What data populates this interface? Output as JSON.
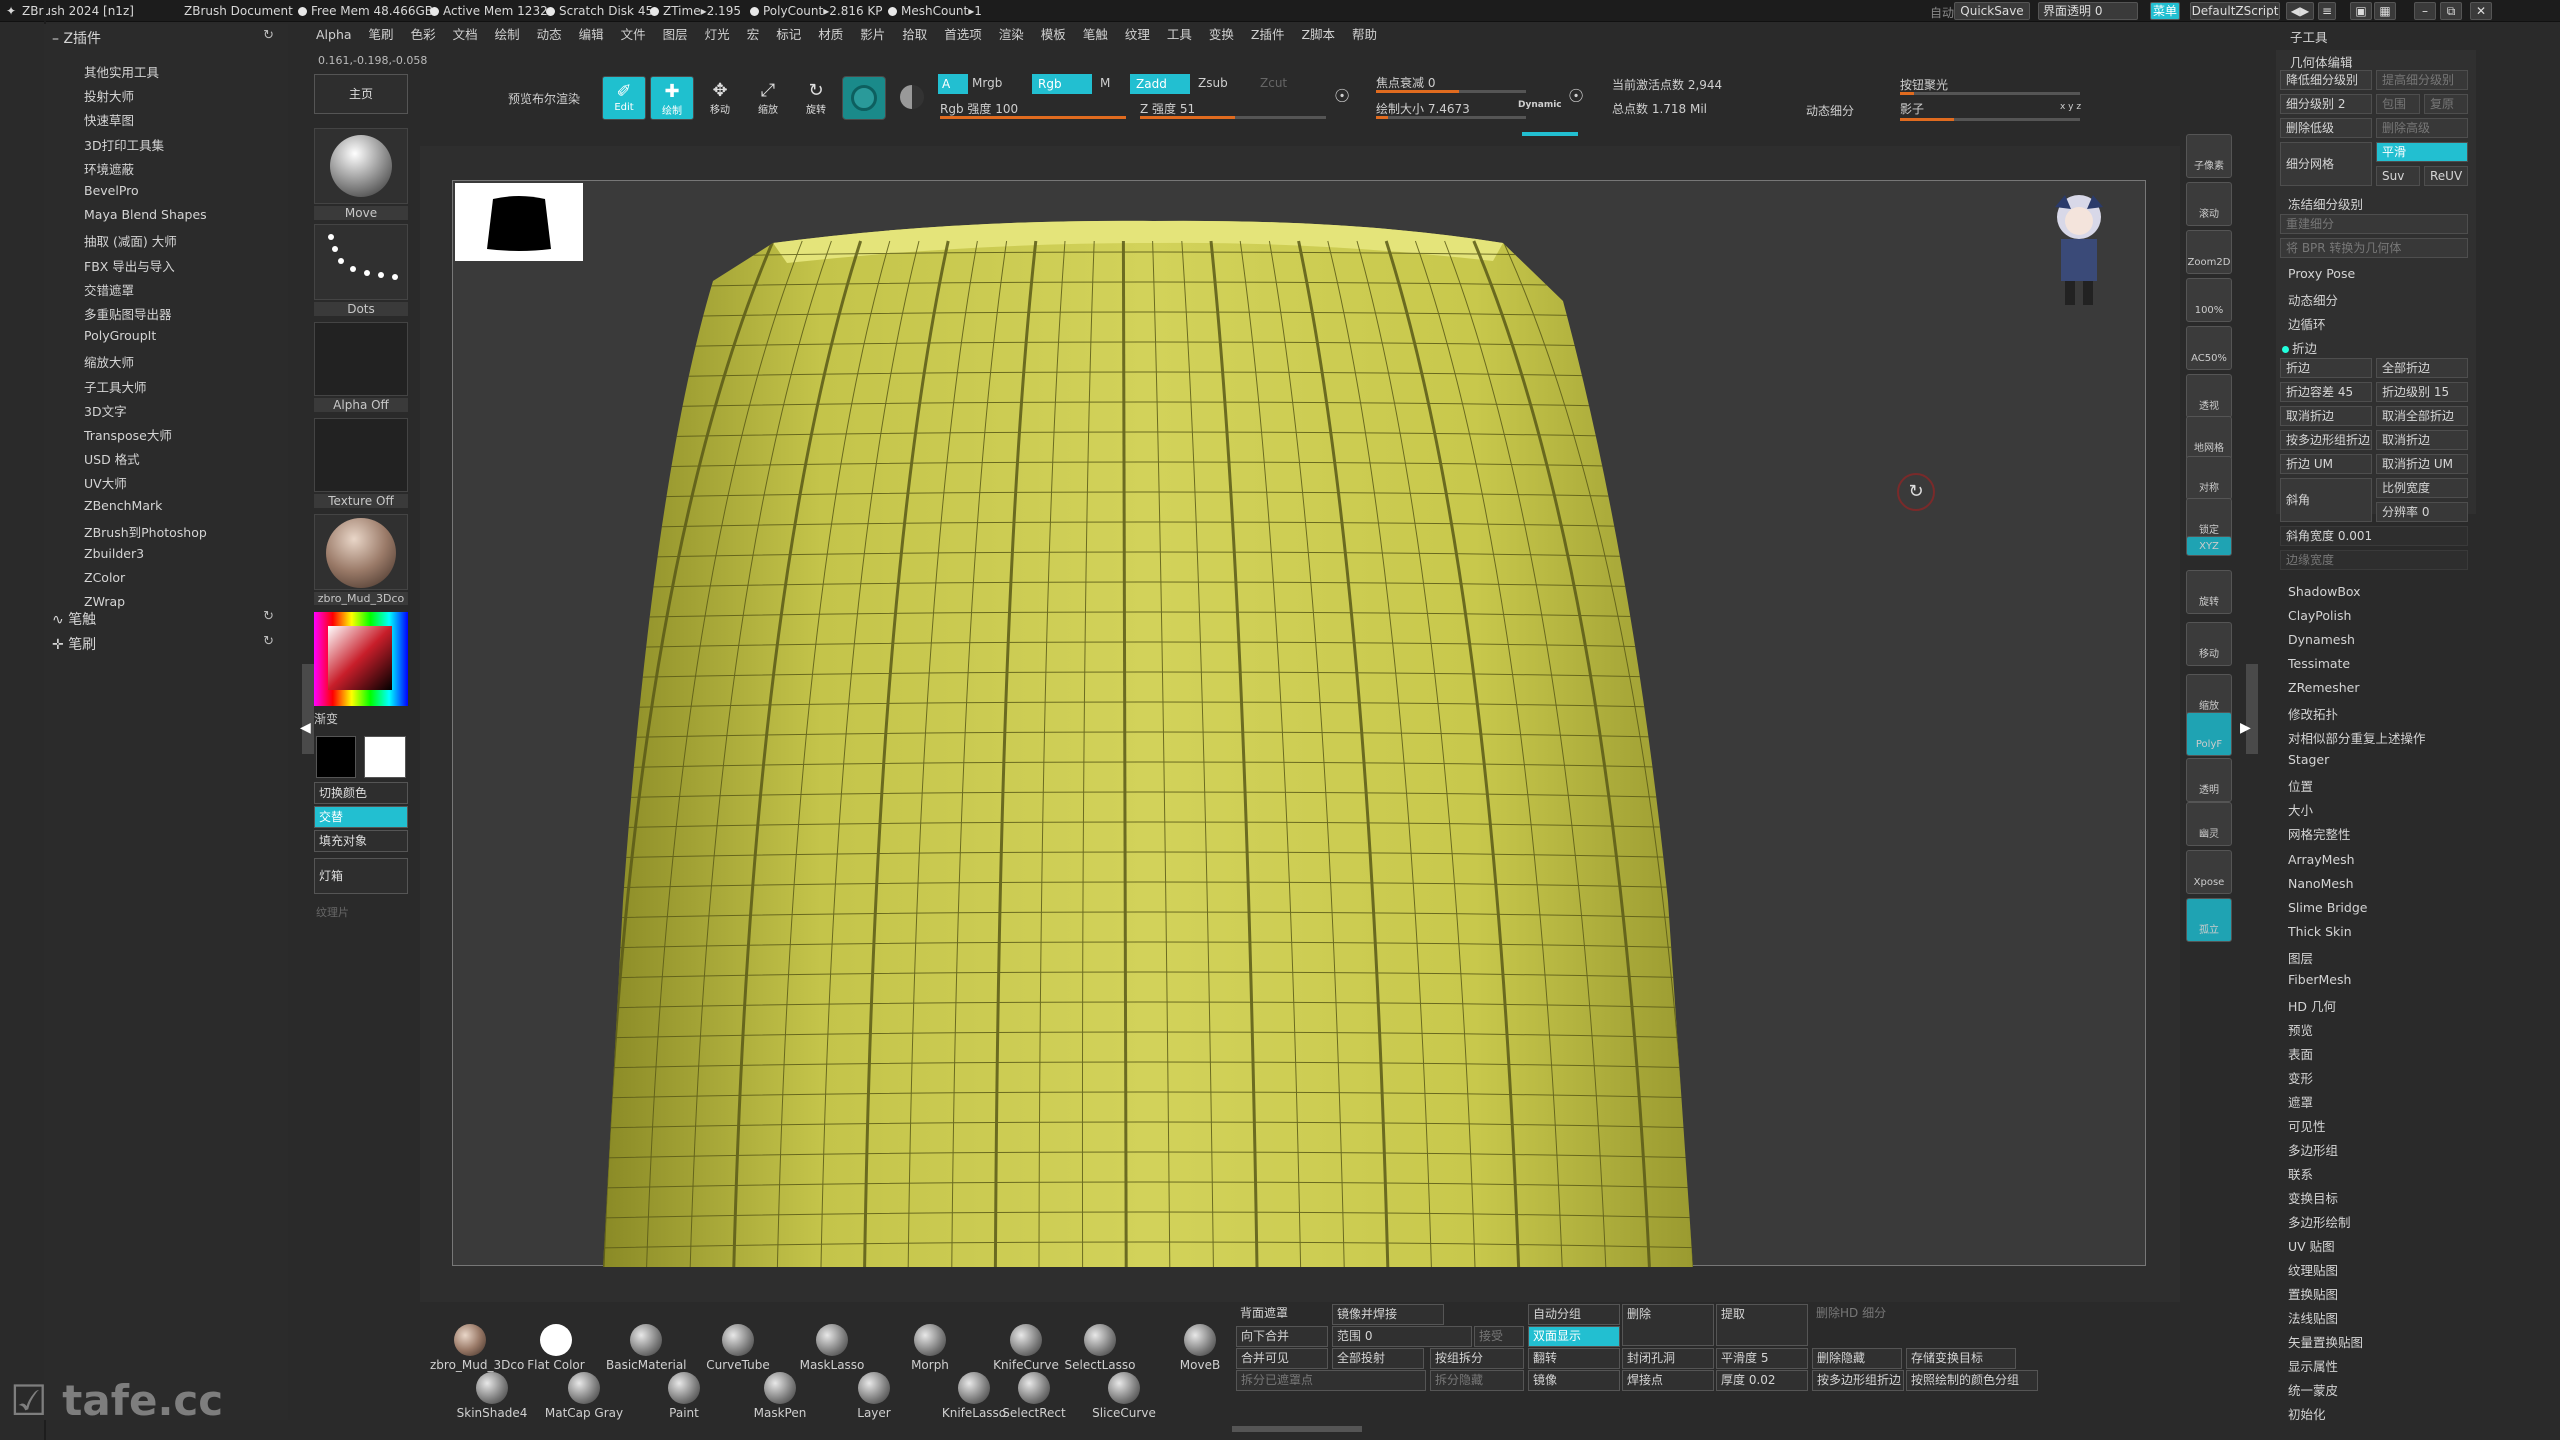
{
  "titlebar": {
    "app": "ZBrush 2024 [n1z]",
    "doc": "ZBrush Document",
    "free_mem": "Free Mem 48.466GB",
    "active_mem": "Active Mem 1232",
    "scratch": "Scratch Disk 45",
    "ztime": "ZTime▸2.195",
    "polycount": "PolyCount▸2.816 KP",
    "meshcount": "MeshCount▸1",
    "autosave": "自动",
    "quicksave": "QuickSave",
    "transparency": "界面透明 0",
    "menu_btn": "菜单",
    "script": "DefaultZScript"
  },
  "menu": [
    "Alpha",
    "笔刷",
    "色彩",
    "文档",
    "绘制",
    "动态",
    "编辑",
    "文件",
    "图层",
    "灯光",
    "宏",
    "标记",
    "材质",
    "影片",
    "拾取",
    "首选项",
    "渲染",
    "模板",
    "笔触",
    "纹理",
    "工具",
    "变换",
    "Z插件",
    "Z脚本",
    "帮助"
  ],
  "coords": "0.161,-0.198,-0.058",
  "left": {
    "header": "Z插件",
    "items": [
      "其他实用工具",
      "投射大师",
      "快速草图",
      "3D打印工具集",
      "环境遮蔽",
      "BevelPro",
      "Maya Blend Shapes",
      "抽取 (减面) 大师",
      "FBX 导出与导入",
      "交错遮罩",
      "多重贴图导出器",
      "PolyGroupIt",
      "缩放大师",
      "子工具大师",
      "3D文字",
      "Transpose大师",
      "USD 格式",
      "UV大师",
      "ZBenchMark",
      "ZBrush到Photoshop",
      "Zbuilder3",
      "ZColor",
      "ZWrap"
    ],
    "footer1": "笔触",
    "footer2": "笔刷"
  },
  "tray": {
    "home": "主页",
    "move": "Move",
    "dots": "Dots",
    "alpha": "Alpha Off",
    "texture": "Texture Off",
    "material": "zbro_Mud_3Dco",
    "gradient": "渐变",
    "switch_color": "切换颜色",
    "alternate": "交替",
    "fill": "填充对象",
    "light": "灯箱",
    "texture_item": "纹理片"
  },
  "toolbar": {
    "preview_bool": "预览布尔渲染",
    "edit": "Edit",
    "draw": "绘制",
    "move": "移动",
    "scale": "缩放",
    "rotate": "旋转",
    "a": "A",
    "mrgb": "Mrgb",
    "rgb": "Rgb",
    "m": "M",
    "zadd": "Zadd",
    "zsub": "Zsub",
    "zcut": "Zcut",
    "rgb_intensity": "Rgb 强度 100",
    "z_intensity": "Z 强度 51",
    "focal_shift": "焦点衰减 0",
    "draw_size": "绘制大小 7.4673",
    "dynamic": "Dynamic",
    "active_points": "当前激活点数 2,944",
    "total_points": "总点数 1.718 Mil",
    "dyn_subdiv": "动态细分",
    "spotlight": "按钮聚光",
    "shadow": "影子",
    "xyz": "x y z"
  },
  "right_shelf": [
    "子像素",
    "滚动",
    "Zoom2D",
    "100%",
    "AC50%",
    "透视",
    "地网格",
    "对称",
    "锁定",
    "XYZ",
    "旋转",
    "移动",
    "缩放",
    "PolyF",
    "透明",
    "幽灵",
    "Xpose",
    "孤立"
  ],
  "right": {
    "subtool": "子工具",
    "geometry": "几何体编辑",
    "lower_res": "降低细分级别",
    "higher_res": "提高细分级别",
    "sdiv": "细分级别 2",
    "cage": "包围",
    "rstr": "复原",
    "del_lower": "删除低级",
    "del_higher": "删除高级",
    "divide": "细分网格",
    "smooth": "平滑",
    "suv": "Suv",
    "reuv": "ReUV",
    "freeze": "冻结细分级别",
    "reconstruct": "重建细分",
    "convert_bpr": "将 BPR 转换为几何体",
    "proxy": "Proxy Pose",
    "dyn_sub": "动态细分",
    "edge_loop": "边循环",
    "crease_sec": "折边",
    "crease": "折边",
    "crease_all": "全部折边",
    "crease_tol": "折边容差 45",
    "crease_lvl": "折边级别 15",
    "uncrease": "取消折边",
    "uncrease_all": "取消全部折边",
    "crease_pg": "按多边形组折边",
    "uncrease_pg": "取消折边",
    "crease_uv": "折边 UM",
    "uncrease_uv": "取消折边 UM",
    "bevel": "斜角",
    "bevel_w": "比例宽度",
    "bevel_res": "分辨率 0",
    "bevel_width": "斜角宽度 0.001",
    "edge_profile": "边缘宽度",
    "list1": [
      "ShadowBox",
      "ClayPolish",
      "Dynamesh",
      "Tessimate",
      "ZRemesher",
      "修改拓扑",
      "对相似部分重复上述操作",
      "Stager",
      "位置",
      "大小",
      "网格完整性"
    ],
    "list2": [
      "ArrayMesh",
      "NanoMesh",
      "Slime Bridge",
      "Thick Skin",
      "图层",
      "FiberMesh",
      "HD 几何",
      "预览",
      "表面",
      "变形",
      "遮罩",
      "可见性",
      "多边形组",
      "联系",
      "变换目标",
      "多边形绘制",
      "UV 贴图",
      "纹理贴图",
      "置换贴图",
      "法线贴图",
      "矢量置换贴图",
      "显示属性",
      "统一蒙皮",
      "初始化"
    ]
  },
  "bottom": {
    "brushes1": [
      "zbro_Mud_3Dco",
      "Flat Color",
      "BasicMaterial",
      "CurveTube",
      "MaskLasso",
      "Morph",
      "KnifeCurve",
      "SelectLasso",
      "MoveB"
    ],
    "brushes2": [
      "SkinShade4",
      "MatCap Gray",
      "Paint",
      "MaskPen",
      "Layer",
      "KnifeLasso",
      "SelectRect",
      "SliceCurve"
    ],
    "b_backface": "背面遮罩",
    "b_mirror_weld": "镜像并焊接",
    "b_auto_group": "自动分组",
    "b_delete": "删除",
    "b_extract": "提取",
    "b_del_hd": "删除HD 细分",
    "b_merge_down": "向下合并",
    "b_range": "范围 0",
    "b_accept": "接受",
    "b_double": "双面显示",
    "b_merge_visible": "合并可见",
    "b_project_all": "全部投射",
    "b_split_group": "按组拆分",
    "b_flip": "翻转",
    "b_close_holes": "封闭孔洞",
    "b_smooth5": "平滑度 5",
    "b_del_hidden": "删除隐藏",
    "b_store_morph": "存储变换目标",
    "b_split_mask": "拆分已遮罩点",
    "b_split_hidden": "拆分隐藏",
    "b_mirror": "镜像",
    "b_weld": "焊接点",
    "b_thick": "厚度 0.02",
    "b_crease_pg": "按多边形组折边",
    "b_group_by_color": "按照绘制的颜色分组"
  },
  "watermark": "tafe.cc",
  "colors": {
    "accent": "#22bfd1",
    "mesh": "#c8c84a",
    "slider": "#e06b1f"
  }
}
